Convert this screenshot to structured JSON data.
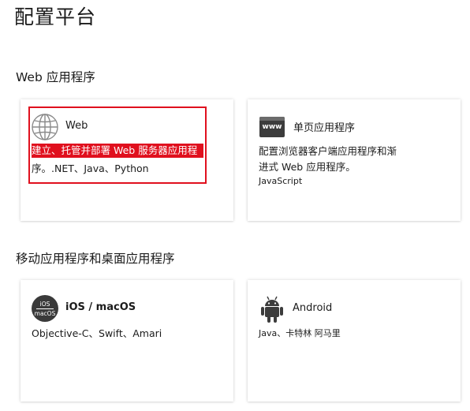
{
  "page": {
    "title": "配置平台"
  },
  "sections": [
    {
      "heading": "Web 应用程序"
    },
    {
      "heading": "移动应用程序和桌面应用程序"
    }
  ],
  "cards": {
    "web": {
      "title": "Web",
      "desc_line1": "建立、托管并部署 Web 服务器应用程",
      "desc_line2": "序。.NET、Java、Python",
      "icon": "globe-icon"
    },
    "spa": {
      "title": "单页应用程序",
      "desc_line1": "配置浏览器客户端应用程序和渐",
      "desc_line2": "进式 Web 应用程序。",
      "tags": "JavaScript",
      "icon_text": "www",
      "icon": "www-window-icon"
    },
    "ios": {
      "title": "iOS / macOS",
      "desc_line1": "Objective-C、Swift、Amari",
      "icon_line1": "iOS",
      "icon_line2": "macOS",
      "icon": "ios-macos-icon"
    },
    "android": {
      "title": "Android",
      "desc_line1": "Java、卡特林 阿马里",
      "icon": "android-icon"
    }
  },
  "colors": {
    "highlight": "#e0101e",
    "card_background": "#ffffff",
    "text": "#1b1b1b"
  }
}
